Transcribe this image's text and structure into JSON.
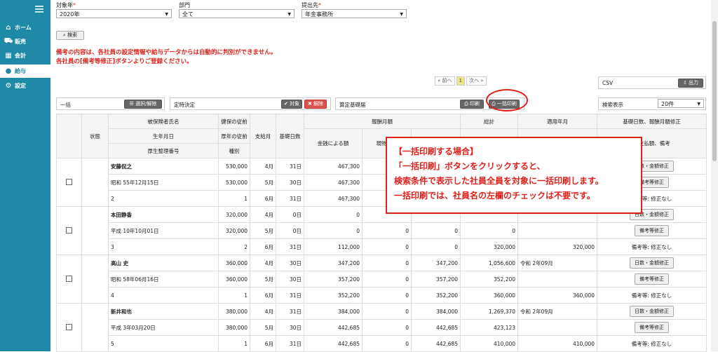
{
  "sidebar": {
    "items": [
      {
        "label": "ホーム",
        "icon": "home-icon",
        "glyph": "⌂",
        "active": false
      },
      {
        "label": "販売",
        "icon": "truck-icon",
        "glyph": "⛟",
        "active": false
      },
      {
        "label": "会計",
        "icon": "calculator-icon",
        "glyph": "▦",
        "active": false
      },
      {
        "label": "給与",
        "icon": "money-bag-icon",
        "glyph": "●",
        "active": true
      },
      {
        "label": "設定",
        "icon": "gear-icon",
        "glyph": "⚙",
        "active": false
      }
    ]
  },
  "filters": {
    "year_label": "対象年",
    "year_value": "2020年",
    "dept_label": "部門",
    "dept_value": "全て",
    "dest_label": "提出先",
    "dest_value": "年金事務所",
    "required_mark": "*"
  },
  "search_button": "⌕ 検索",
  "notes": [
    "備考の内容は、各社員の設定情報や給与データからは自動的に判別ができません。",
    "各社員の[備考等修正]ボタンよりご登録ください。"
  ],
  "pager": {
    "prev": "« 前へ",
    "page": "1",
    "next": "次へ »"
  },
  "csv": {
    "label": "CSV",
    "button": "⇩ 出力"
  },
  "bulk": {
    "label": "一括",
    "toggle_button": "☰ 選択/解除"
  },
  "decision": {
    "label": "定時決定",
    "target_button": "✔ 対象",
    "release_button": "✖ 解除"
  },
  "calc": {
    "label": "算定基礎届",
    "print_button": "⎙ 印刷",
    "bulk_print_button": "⎙ 一括印刷"
  },
  "display": {
    "label": "検索表示",
    "value": "20件"
  },
  "table": {
    "h_status": "状態",
    "h_name": "被保険者氏名",
    "h_birth": "生年月日",
    "h_num": "厚生整理番号",
    "h_health": "健保の従前",
    "h_pension": "厚年の従前",
    "h_type": "種別",
    "h_month": "支給月",
    "h_days": "基礎日数",
    "h_reward": "報酬月額",
    "h_money": "金銭による額",
    "h_goods": "現物によ",
    "h_total": "総計",
    "h_apply": "適用年月",
    "h_fix": "基礎日数、報酬月額修正",
    "h_note": "及支払額、備考"
  },
  "employees": [
    {
      "name": "安藤侃之",
      "birth": "昭和 55年12月15日",
      "num": "2",
      "health": "530,000",
      "pension": "530,000",
      "type": "1",
      "rows": [
        {
          "m": "4月",
          "d": "31日",
          "money": "467,300",
          "goods": "",
          "gsum": "",
          "total": "",
          "apply": "",
          "avg": ""
        },
        {
          "m": "5月",
          "d": "30日",
          "money": "467,300",
          "goods": "",
          "gsum": "",
          "total": "",
          "apply": "",
          "avg": ""
        },
        {
          "m": "6月",
          "d": "31日",
          "money": "467,300",
          "goods": "",
          "gsum": "",
          "total": "",
          "apply": "",
          "avg": ""
        }
      ],
      "fix1": "日数・金額修正",
      "fix2": "備考等修正",
      "remark": "備考等: 修正なし"
    },
    {
      "name": "本田静香",
      "birth": "平成 10年10月01日",
      "num": "3",
      "health": "320,000",
      "pension": "320,000",
      "type": "2",
      "rows": [
        {
          "m": "4月",
          "d": "0日",
          "money": "0",
          "goods": "",
          "gsum": "",
          "total": "",
          "apply": "",
          "avg": ""
        },
        {
          "m": "5月",
          "d": "0日",
          "money": "0",
          "goods": "0",
          "gsum": "0",
          "total": "0",
          "apply": "",
          "avg": ""
        },
        {
          "m": "6月",
          "d": "31日",
          "money": "112,000",
          "goods": "0",
          "gsum": "0",
          "total": "320,000",
          "apply": "",
          "avg": "320,000"
        }
      ],
      "fix1": "日数・金額修正",
      "fix2": "備考等修正",
      "remark": "備考等: 修正なし"
    },
    {
      "name": "高山 史",
      "birth": "昭和 58年06月16日",
      "num": "4",
      "health": "360,000",
      "pension": "360,000",
      "type": "1",
      "rows": [
        {
          "m": "4月",
          "d": "30日",
          "money": "347,200",
          "goods": "0",
          "gsum": "347,200",
          "total": "1,056,600",
          "apply": "令和 2年09月",
          "avg": ""
        },
        {
          "m": "5月",
          "d": "30日",
          "money": "357,200",
          "goods": "0",
          "gsum": "357,200",
          "total": "352,200",
          "apply": "",
          "avg": ""
        },
        {
          "m": "6月",
          "d": "31日",
          "money": "352,200",
          "goods": "0",
          "gsum": "352,200",
          "total": "360,000",
          "apply": "",
          "avg": "360,000"
        }
      ],
      "fix1": "日数・金額修正",
      "fix2": "備考等修正",
      "remark": "備考等: 修正なし"
    },
    {
      "name": "新井和也",
      "birth": "平成 3年03月20日",
      "num": "5",
      "health": "380,000",
      "pension": "380,000",
      "type": "1",
      "rows": [
        {
          "m": "4月",
          "d": "31日",
          "money": "384,000",
          "goods": "0",
          "gsum": "384,000",
          "total": "1,269,370",
          "apply": "令和 2年09月",
          "avg": ""
        },
        {
          "m": "5月",
          "d": "30日",
          "money": "442,685",
          "goods": "0",
          "gsum": "442,685",
          "total": "423,123",
          "apply": "",
          "avg": ""
        },
        {
          "m": "6月",
          "d": "31日",
          "money": "442,685",
          "goods": "0",
          "gsum": "442,685",
          "total": "410,000",
          "apply": "",
          "avg": "410,000"
        }
      ],
      "fix1": "日数・金額修正",
      "fix2": "備考等修正",
      "remark": "備考等: 修正なし"
    }
  ],
  "callout": {
    "title": "【一括印刷する場合】",
    "lines": [
      "「一括印刷」ボタンをクリックすると、",
      "検索条件で表示した社員全員を対象に一括印刷します。",
      "一括印刷では、社員名の左欄のチェックは不要です。"
    ]
  }
}
